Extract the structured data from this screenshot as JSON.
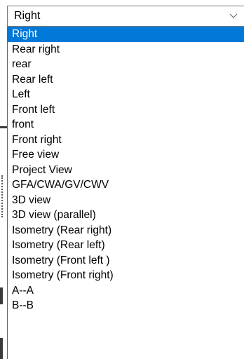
{
  "combo": {
    "value": "Right",
    "arrow_icon": "chevron-down-icon"
  },
  "dropdown": {
    "selected_index": 0,
    "accent_color": "#0078d7",
    "items": [
      {
        "label": "Right"
      },
      {
        "label": "Rear right"
      },
      {
        "label": "rear"
      },
      {
        "label": "Rear left"
      },
      {
        "label": "Left"
      },
      {
        "label": "Front left"
      },
      {
        "label": "front"
      },
      {
        "label": "Front right"
      },
      {
        "label": "Free view"
      },
      {
        "label": "Project View"
      },
      {
        "label": "GFA/CWA/GV/CWV"
      },
      {
        "label": "3D view"
      },
      {
        "label": "3D view (parallel)"
      },
      {
        "label": "Isometry (Rear right)"
      },
      {
        "label": "Isometry (Rear left)"
      },
      {
        "label": "Isometry (Front left )"
      },
      {
        "label": "Isometry (Front right)"
      },
      {
        "label": "A--A"
      },
      {
        "label": "B--B"
      }
    ]
  }
}
